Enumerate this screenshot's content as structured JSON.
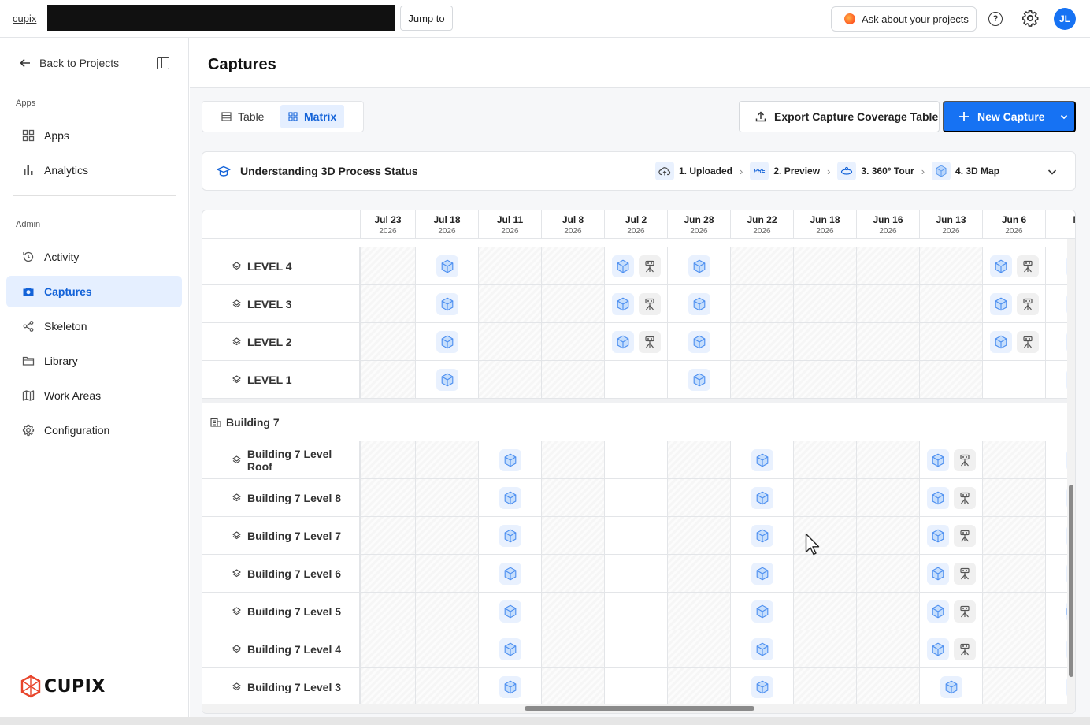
{
  "topbar": {
    "brand": "cupix",
    "jump_label": "Jump to",
    "ask_label": "Ask about your projects",
    "help_glyph": "?",
    "avatar_initials": "JL"
  },
  "sidebar": {
    "back_label": "Back to Projects",
    "apps_section": "Apps",
    "admin_section": "Admin",
    "apps_items": [
      {
        "label": "Apps",
        "icon": "apps-icon"
      },
      {
        "label": "Analytics",
        "icon": "analytics-icon"
      }
    ],
    "admin_items": [
      {
        "label": "Activity",
        "icon": "history-icon"
      },
      {
        "label": "Captures",
        "icon": "camera-icon",
        "active": true
      },
      {
        "label": "Skeleton",
        "icon": "skeleton-icon"
      },
      {
        "label": "Library",
        "icon": "folder-icon"
      },
      {
        "label": "Work Areas",
        "icon": "map-icon"
      },
      {
        "label": "Configuration",
        "icon": "gear-icon"
      }
    ],
    "logo_text": "CUPIX"
  },
  "main": {
    "title": "Captures",
    "view_table": "Table",
    "view_matrix": "Matrix",
    "export_label": "Export Capture Coverage Table",
    "new_label": "New Capture",
    "status": {
      "title": "Understanding 3D Process Status",
      "steps": [
        "1. Uploaded",
        "2. Preview",
        "3. 360° Tour",
        "4. 3D Map"
      ],
      "preview_badge": "PRE"
    }
  },
  "matrix": {
    "dates": [
      {
        "date": "Jul 23",
        "year": "2026"
      },
      {
        "date": "Jul 18",
        "year": "2026"
      },
      {
        "date": "Jul 11",
        "year": "2026"
      },
      {
        "date": "Jul 8",
        "year": "2026"
      },
      {
        "date": "Jul 2",
        "year": "2026"
      },
      {
        "date": "Jun 28",
        "year": "2026"
      },
      {
        "date": "Jun 22",
        "year": "2026"
      },
      {
        "date": "Jun 18",
        "year": "2026"
      },
      {
        "date": "Jun 16",
        "year": "2026"
      },
      {
        "date": "Jun 13",
        "year": "2026"
      },
      {
        "date": "Jun 6",
        "year": "2026"
      },
      {
        "date": "M",
        "year": ""
      }
    ],
    "group1_rows": [
      {
        "label": "LEVEL 4",
        "cells": [
          "",
          "m",
          "",
          "",
          "mt",
          "m",
          "",
          "",
          "",
          "",
          "mt",
          "p"
        ]
      },
      {
        "label": "LEVEL 3",
        "cells": [
          "",
          "m",
          "",
          "",
          "mt",
          "m",
          "",
          "",
          "",
          "",
          "mt",
          "p"
        ]
      },
      {
        "label": "LEVEL 2",
        "cells": [
          "",
          "m",
          "",
          "",
          "mt",
          "m",
          "",
          "",
          "",
          "",
          "mt",
          "p"
        ]
      },
      {
        "label": "LEVEL 1",
        "cells": [
          "",
          "m",
          "",
          "",
          "",
          "m",
          "",
          "",
          "",
          "",
          "",
          "p"
        ]
      }
    ],
    "group2_title": "Building 7",
    "group2_rows": [
      {
        "label": "Building 7 Level Roof",
        "cells": [
          "",
          "",
          "m",
          "",
          "",
          "",
          "m",
          "",
          "",
          "mt",
          "",
          "p"
        ]
      },
      {
        "label": "Building 7 Level 8",
        "cells": [
          "",
          "",
          "m",
          "",
          "",
          "",
          "m",
          "",
          "",
          "mt",
          "",
          "p"
        ]
      },
      {
        "label": "Building 7 Level 7",
        "cells": [
          "",
          "",
          "m",
          "",
          "",
          "",
          "m",
          "",
          "",
          "mt",
          "",
          "p"
        ]
      },
      {
        "label": "Building 7 Level 6",
        "cells": [
          "",
          "",
          "m",
          "",
          "",
          "",
          "m",
          "",
          "",
          "mt",
          "",
          "p"
        ]
      },
      {
        "label": "Building 7 Level 5",
        "cells": [
          "",
          "",
          "m",
          "",
          "",
          "",
          "m",
          "",
          "",
          "mt",
          "",
          "pm"
        ]
      },
      {
        "label": "Building 7 Level 4",
        "cells": [
          "",
          "",
          "m",
          "",
          "",
          "",
          "m",
          "",
          "",
          "mt",
          "",
          "p"
        ]
      },
      {
        "label": "Building 7 Level 3",
        "cells": [
          "",
          "",
          "m",
          "",
          "",
          "",
          "m",
          "",
          "",
          "m",
          "",
          "p"
        ]
      }
    ]
  },
  "colors": {
    "accent": "#1672f3",
    "active_bg": "#e5efff"
  }
}
